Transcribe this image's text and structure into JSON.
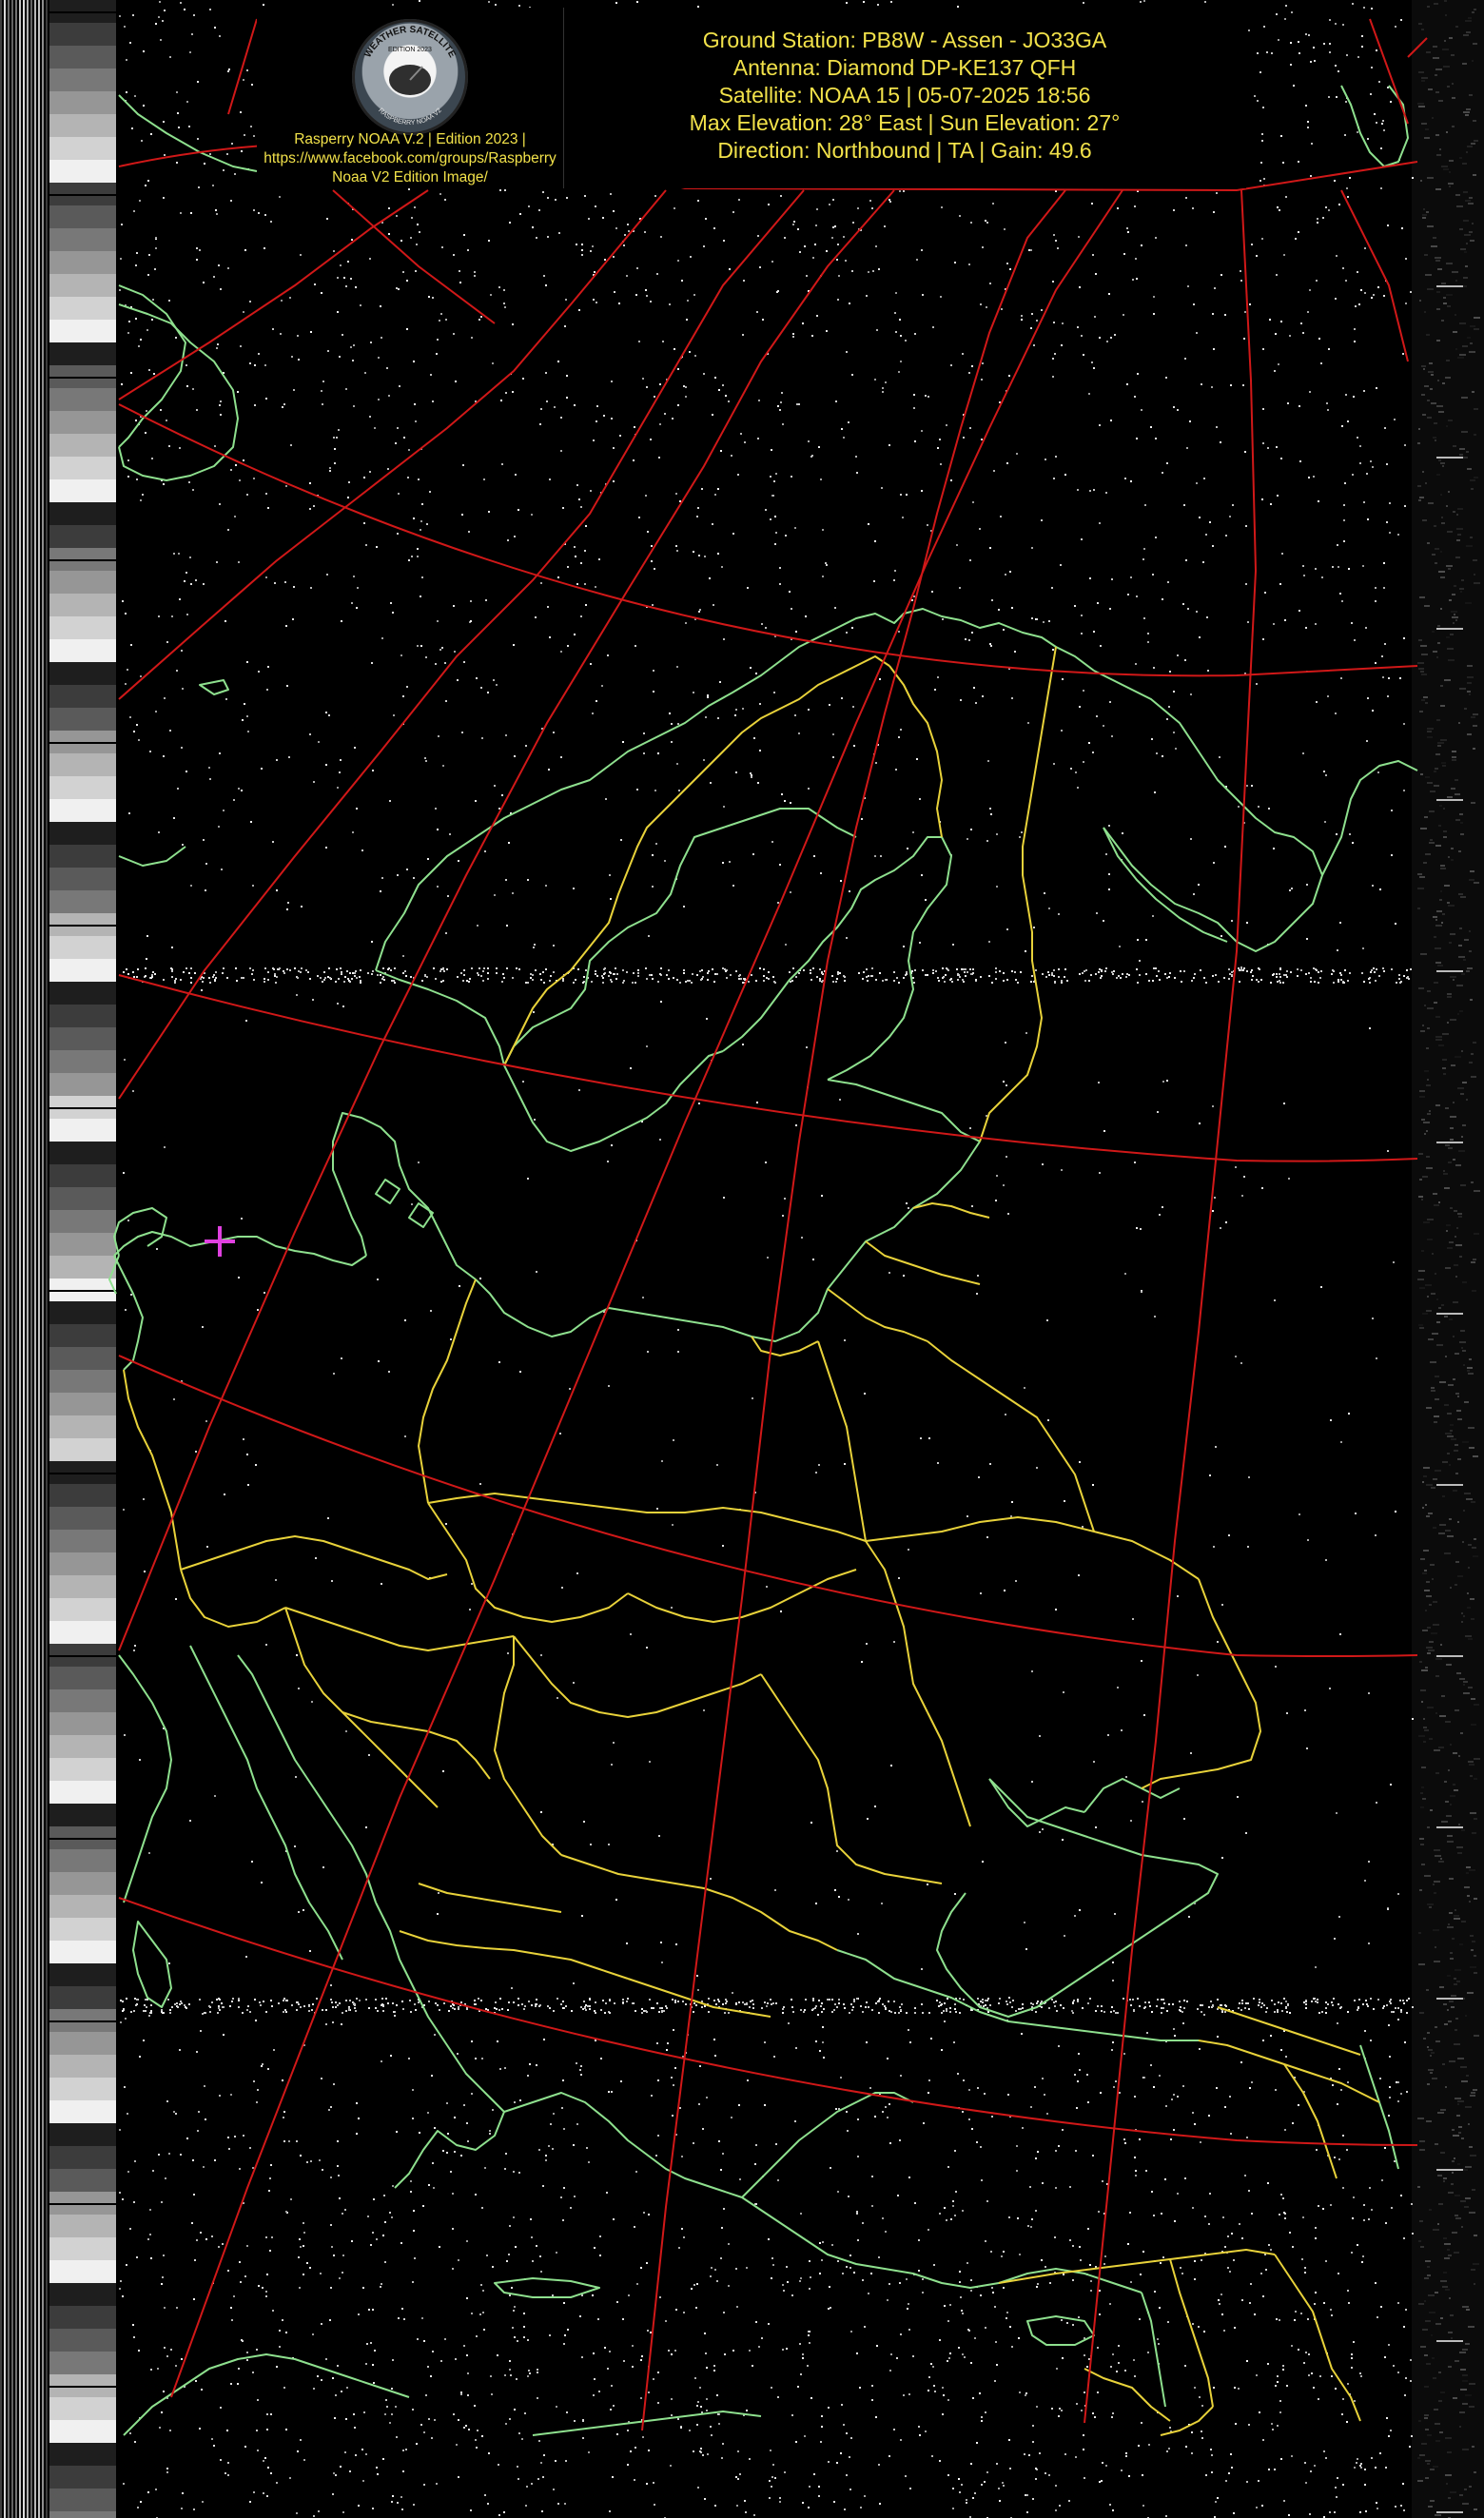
{
  "header": {
    "ground_station": "Ground Station: PB8W - Assen - JO33GA",
    "antenna": "Antenna: Diamond DP-KE137 QFH",
    "satellite": "Satellite: NOAA 15 | 05-07-2025 18:56",
    "elevation": "Max Elevation: 28° East | Sun Elevation: 27°",
    "direction": "Direction: Northbound | TA | Gain: 49.6"
  },
  "logo": {
    "ring_text_top": "WEATHER SATELLITE",
    "ring_text_year": "EDITION 2023",
    "ring_text_bottom": "RASPBERRY NOAA V2",
    "credit_1": "Rasperry NOAA V.2 | Edition 2023 |",
    "credit_2": "https://www.facebook.com/groups/Raspberry",
    "credit_3": "Noaa V2 Edition Image/"
  },
  "colors": {
    "background": "#000000",
    "graticule": "#d01818",
    "coastline": "#8ee08e",
    "borders": "#e8d23a",
    "text": "#f2e24a",
    "station_marker": "#e040e0",
    "noise": "#e8e8e8"
  },
  "icons": {
    "station_marker": "plus-marker-icon",
    "logo": "satellite-dish-badge-icon"
  },
  "layers": [
    "graticule",
    "coastlines",
    "country-borders",
    "ground-station-marker",
    "telemetry-strips",
    "apt-noise"
  ]
}
